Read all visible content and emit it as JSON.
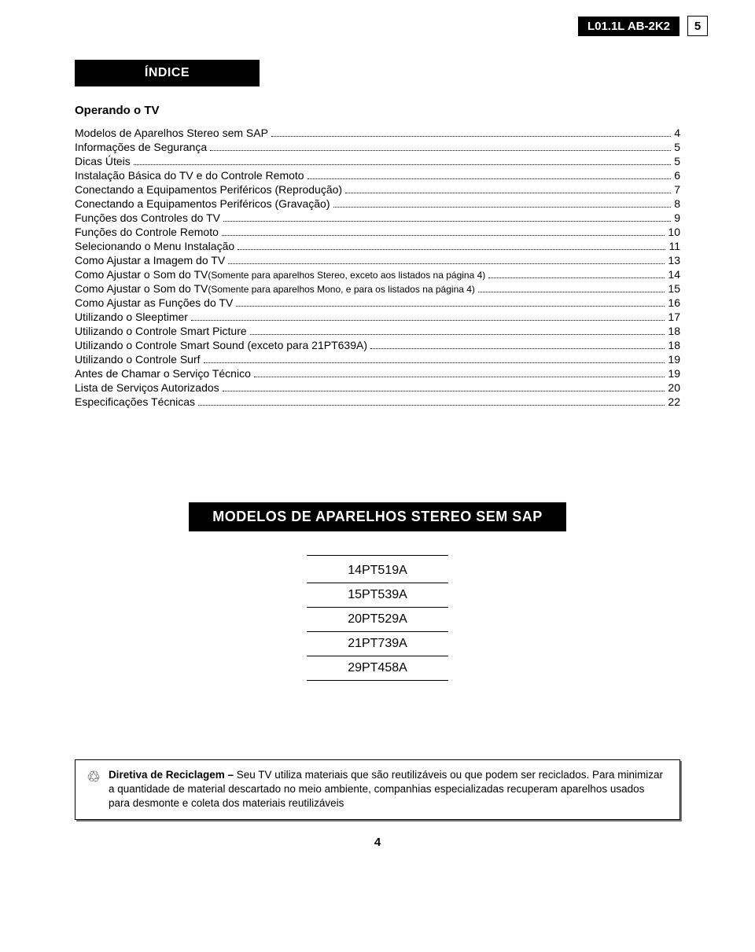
{
  "header": {
    "badge": "L01.1L AB-2K2",
    "page_box": "5"
  },
  "indice_title": "ÍNDICE",
  "subheading": "Operando o TV",
  "toc": [
    {
      "label": "Modelos de Aparelhos Stereo sem SAP",
      "page": "4"
    },
    {
      "label": "Informações de Segurança",
      "page": "5"
    },
    {
      "label": "Dicas Úteis",
      "page": "5"
    },
    {
      "label": "Instalação Básica do TV e do Controle Remoto",
      "page": "6"
    },
    {
      "label": "Conectando a Equipamentos Periféricos (Reprodução)",
      "page": "7"
    },
    {
      "label": "Conectando a Equipamentos Periféricos (Gravação)",
      "page": "8"
    },
    {
      "label": "Funções dos Controles do TV",
      "page": "9"
    },
    {
      "label": "Funções do Controle Remoto",
      "page": "10"
    },
    {
      "label": "Selecionando o Menu Instalação",
      "page": "11"
    },
    {
      "label": "Como Ajustar a Imagem do TV",
      "page": "13"
    },
    {
      "label": "Como Ajustar o Som do TV ",
      "sub": "(Somente para aparelhos Stereo, exceto aos listados na página 4)",
      "page": "14"
    },
    {
      "label": "Como Ajustar o Som do TV ",
      "sub": "(Somente para aparelhos Mono, e para os listados na página 4)",
      "page": "15"
    },
    {
      "label": "Como Ajustar as Funções do TV",
      "page": "16"
    },
    {
      "label": "Utilizando o Sleeptimer",
      "page": "17"
    },
    {
      "label": "Utilizando o Controle Smart Picture",
      "page": "18"
    },
    {
      "label": "Utilizando o Controle Smart Sound (exceto para 21PT639A)",
      "page": "18"
    },
    {
      "label": "Utilizando o Controle Surf",
      "page": "19"
    },
    {
      "label": "Antes de Chamar o Serviço Técnico",
      "page": "19"
    },
    {
      "label": "Lista de Serviços Autorizados",
      "page": "20"
    },
    {
      "label": "Especificações Técnicas",
      "page": "22"
    }
  ],
  "models_title": "MODELOS DE APARELHOS STEREO SEM SAP",
  "models": [
    "14PT519A",
    "15PT539A",
    "20PT529A",
    "21PT739A",
    "29PT458A"
  ],
  "recycle": {
    "title": "Diretiva de Reciclagem – ",
    "body": "Seu TV utiliza materiais que são reutilizáveis ou que podem ser reciclados. Para minimizar a quantidade de material descartado no meio ambiente, companhias especializadas recuperam aparelhos usados para desmonte e coleta dos materiais reutilizáveis"
  },
  "footer_pagenum": "4"
}
